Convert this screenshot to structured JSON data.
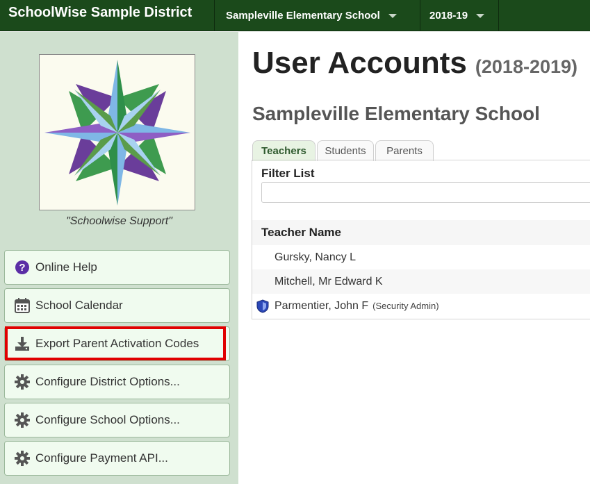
{
  "topbar": {
    "brand": "SchoolWise Sample District",
    "school_select": "Sampleville Elementary School",
    "year_select": "2018-19"
  },
  "sidebar": {
    "logo_caption": "\"Schoolwise Support\"",
    "buttons": [
      {
        "label": "Online Help",
        "icon": "question-circle-icon"
      },
      {
        "label": "School Calendar",
        "icon": "calendar-icon"
      },
      {
        "label": "Export Parent Activation Codes",
        "icon": "download-icon"
      },
      {
        "label": "Configure District Options...",
        "icon": "gear-icon"
      },
      {
        "label": "Configure School Options...",
        "icon": "gear-icon"
      },
      {
        "label": "Configure Payment API...",
        "icon": "gear-icon"
      }
    ],
    "highlight_color": "#e00000"
  },
  "main": {
    "title": "User Accounts",
    "year": "(2018-2019)",
    "school": "Sampleville Elementary School",
    "tabs": [
      "Teachers",
      "Students",
      "Parents"
    ],
    "active_tab": "Teachers",
    "filter_label": "Filter List",
    "filter_value": "",
    "column_header": "Teacher Name",
    "rows": [
      {
        "name": "Gursky, Nancy L",
        "role": ""
      },
      {
        "name": "Mitchell, Mr Edward K",
        "role": ""
      },
      {
        "name": "Parmentier, John F",
        "role": "(Security Admin)"
      }
    ]
  },
  "colors": {
    "topbar": "#1b4a1b",
    "sidebar": "#cfe0cf",
    "button_bg": "#f0fbef"
  }
}
